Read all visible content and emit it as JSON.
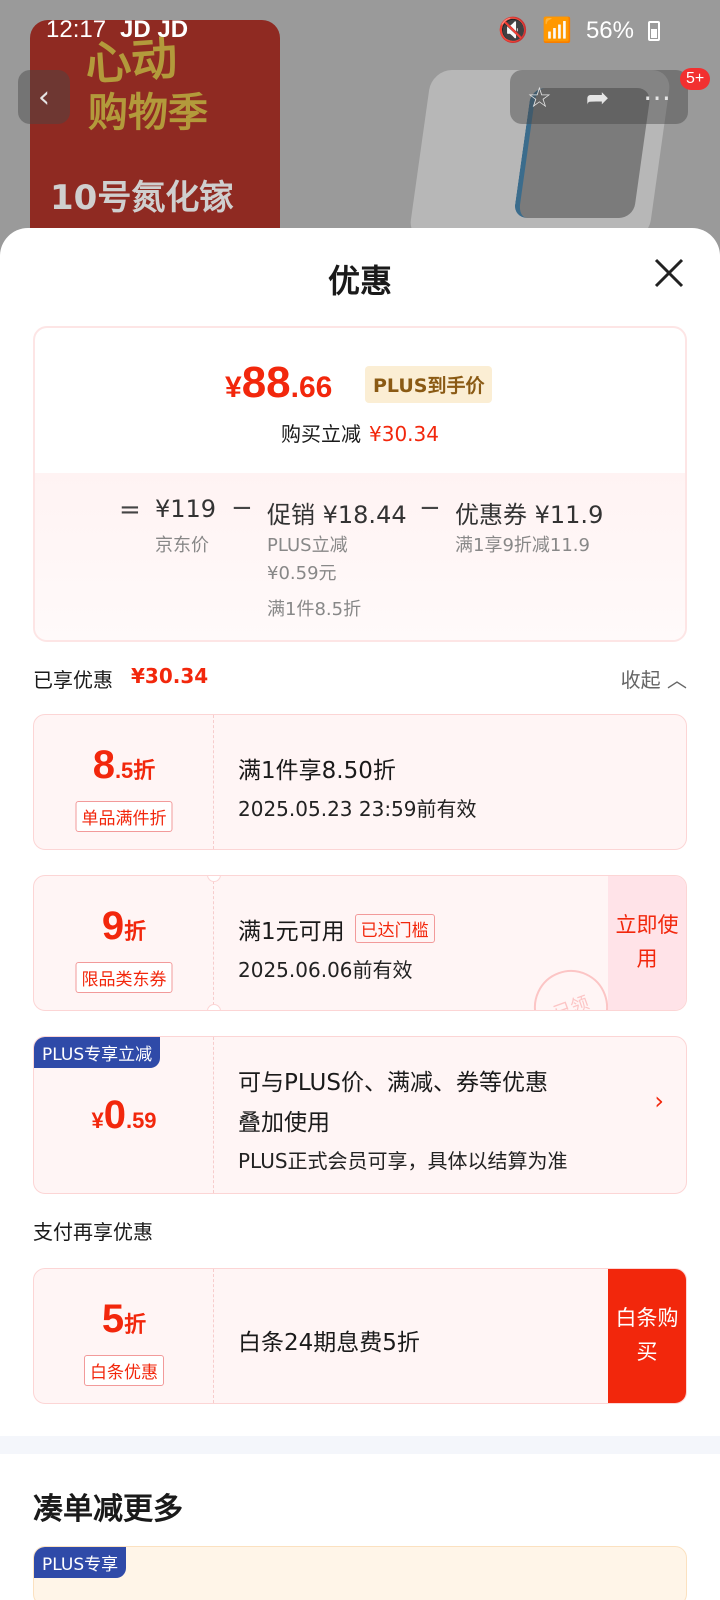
{
  "status_bar": {
    "time": "12:17",
    "apps": "JD JD",
    "battery": "56%"
  },
  "background": {
    "poster_line1": "心动",
    "poster_line2": "购物季",
    "poster_line3": "10号氮化镓",
    "message_badge": "5+"
  },
  "sheet": {
    "title": "优惠",
    "summary": {
      "price_symbol": "¥",
      "price_int": "88",
      "price_dec": ".66",
      "price_tag": "PLUS到手价",
      "reduce_label": "购买立减",
      "reduce_amount": "¥30.34",
      "eq": "=",
      "jd_price": "¥119",
      "jd_price_label": "京东价",
      "minus1": "−",
      "promo": "促销 ¥18.44",
      "promo_line1": "PLUS立减",
      "promo_line2": "¥0.59元",
      "promo_line3": "满1件8.5折",
      "minus2": "−",
      "coupon": "优惠券 ¥11.9",
      "coupon_desc": "满1享9折减11.9"
    },
    "applied": {
      "label": "已享优惠",
      "amount": "¥30.34",
      "collapse": "收起"
    },
    "cards": [
      {
        "disc_big": "8",
        "disc_small": ".5折",
        "tag": "单品满件折",
        "title": "满1件享8.50折",
        "validity": "2025.05.23 23:59前有效"
      },
      {
        "disc_big": "9",
        "disc_small": "折",
        "tag": "限品类东券",
        "title": "满1元可用",
        "reach_tag": "已达门槛",
        "validity": "2025.06.06前有效",
        "action": "立即使用",
        "stamp": "已领"
      },
      {
        "corner": "PLUS专享立减",
        "disc_yen": "¥",
        "disc_big": "0",
        "disc_small": ".59",
        "title_line1": "可与PLUS价、满减、券等优惠",
        "title_line2": "叠加使用",
        "desc": "PLUS正式会员可享，具体以结算为准"
      }
    ],
    "pay_section": {
      "title": "支付再享优惠",
      "card": {
        "disc_big": "5",
        "disc_small": "折",
        "tag": "白条优惠",
        "title": "白条24期息费5折",
        "action": "白条购买"
      }
    },
    "more": {
      "title": "凑单减更多",
      "corner": "PLUS专享"
    }
  }
}
